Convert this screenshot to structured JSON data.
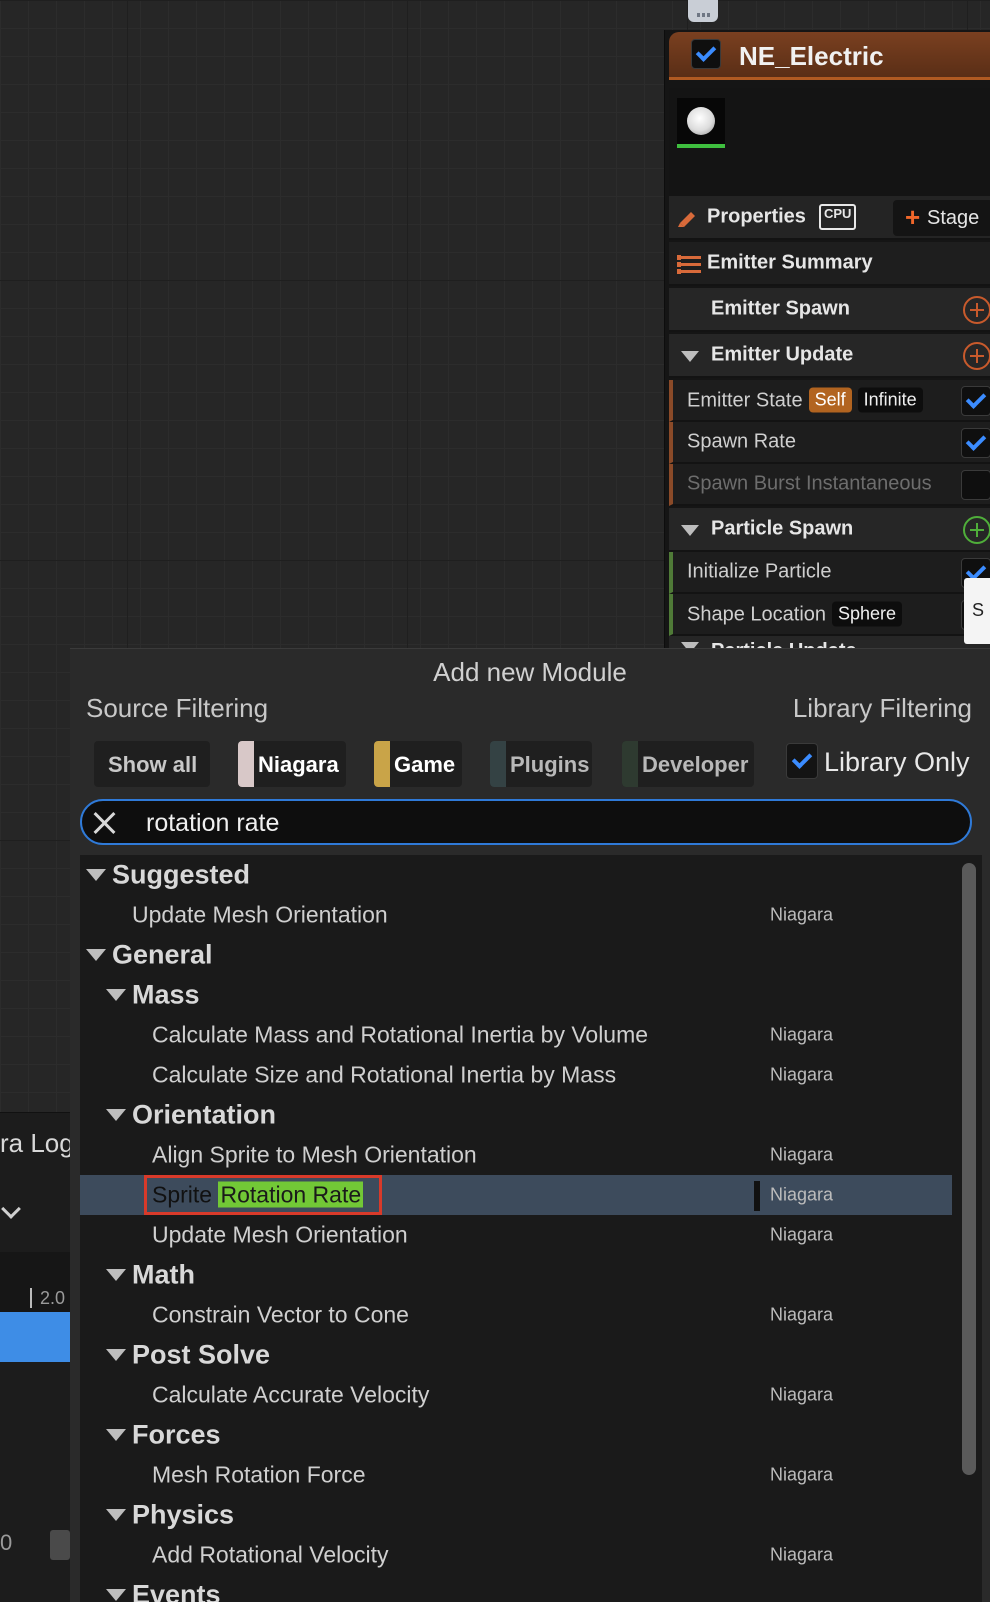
{
  "emitter": {
    "name": "NE_Electric",
    "properties_label": "Properties",
    "cpu_label": "CPU",
    "stage_label": "Stage",
    "summary_label": "Emitter Summary",
    "sections": {
      "emitter_spawn": "Emitter Spawn",
      "emitter_update": "Emitter Update",
      "particle_spawn": "Particle Spawn",
      "particle_update": "Particle Update"
    },
    "modules": {
      "emitter_state": "Emitter State",
      "emitter_state_tag1": "Self",
      "emitter_state_tag2": "Infinite",
      "spawn_rate": "Spawn Rate",
      "spawn_burst": "Spawn Burst Instantaneous",
      "initialize_particle": "Initialize Particle",
      "shape_location": "Shape Location",
      "shape_location_tag": "Sphere"
    },
    "tooltip_stub": "S"
  },
  "left": {
    "log_tab": "ra Log",
    "timeline_label": "2.0",
    "zero_label": "0"
  },
  "popup": {
    "title": "Add new Module",
    "source_filtering": "Source Filtering",
    "library_filtering": "Library Filtering",
    "chips": {
      "show_all": "Show all",
      "niagara": "Niagara",
      "game": "Game",
      "plugins": "Plugins",
      "developer": "Developer"
    },
    "library_only": "Library Only",
    "search": {
      "value": "rotation rate"
    },
    "results": {
      "suggested": "Suggested",
      "suggested_item": "Update Mesh Orientation",
      "general": "General",
      "mass": "Mass",
      "mass_item1": "Calculate Mass and Rotational Inertia by Volume",
      "mass_item2": "Calculate Size and Rotational Inertia by Mass",
      "orientation": "Orientation",
      "orient_item1": "Align Sprite to Mesh Orientation",
      "orient_item2_prefix": "Sprite ",
      "orient_item2_match": "Rotation Rate",
      "orient_item3": "Update Mesh Orientation",
      "math": "Math",
      "math_item": "Constrain Vector to Cone",
      "post_solve": "Post Solve",
      "post_solve_item": "Calculate Accurate Velocity",
      "forces": "Forces",
      "forces_item": "Mesh Rotation Force",
      "physics": "Physics",
      "physics_item": "Add Rotational Velocity",
      "events": "Events",
      "source": "Niagara"
    }
  },
  "colors": {
    "accent_blue": "#2f7ad8",
    "highlight_green": "#72c836",
    "selection_red": "#d83a2a",
    "emitter_orange": "#b05a22"
  }
}
